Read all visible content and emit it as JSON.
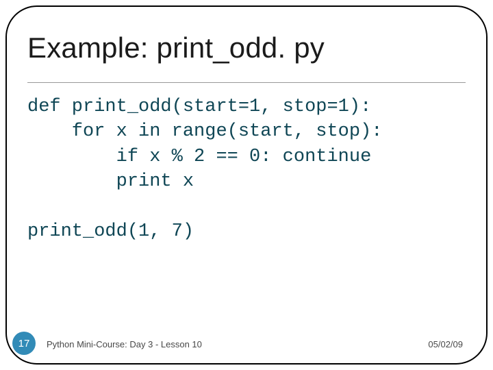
{
  "title": "Example: print_odd. py",
  "code": {
    "line1": "def print_odd(start=1, stop=1):",
    "line2": "    for x in range(start, stop):",
    "line3": "        if x % 2 == 0: continue",
    "line4": "        print x",
    "line5": "",
    "line6": "print_odd(1, 7)"
  },
  "footer": {
    "page": "17",
    "course": "Python Mini-Course: Day 3 - Lesson 10",
    "date": "05/02/09"
  }
}
